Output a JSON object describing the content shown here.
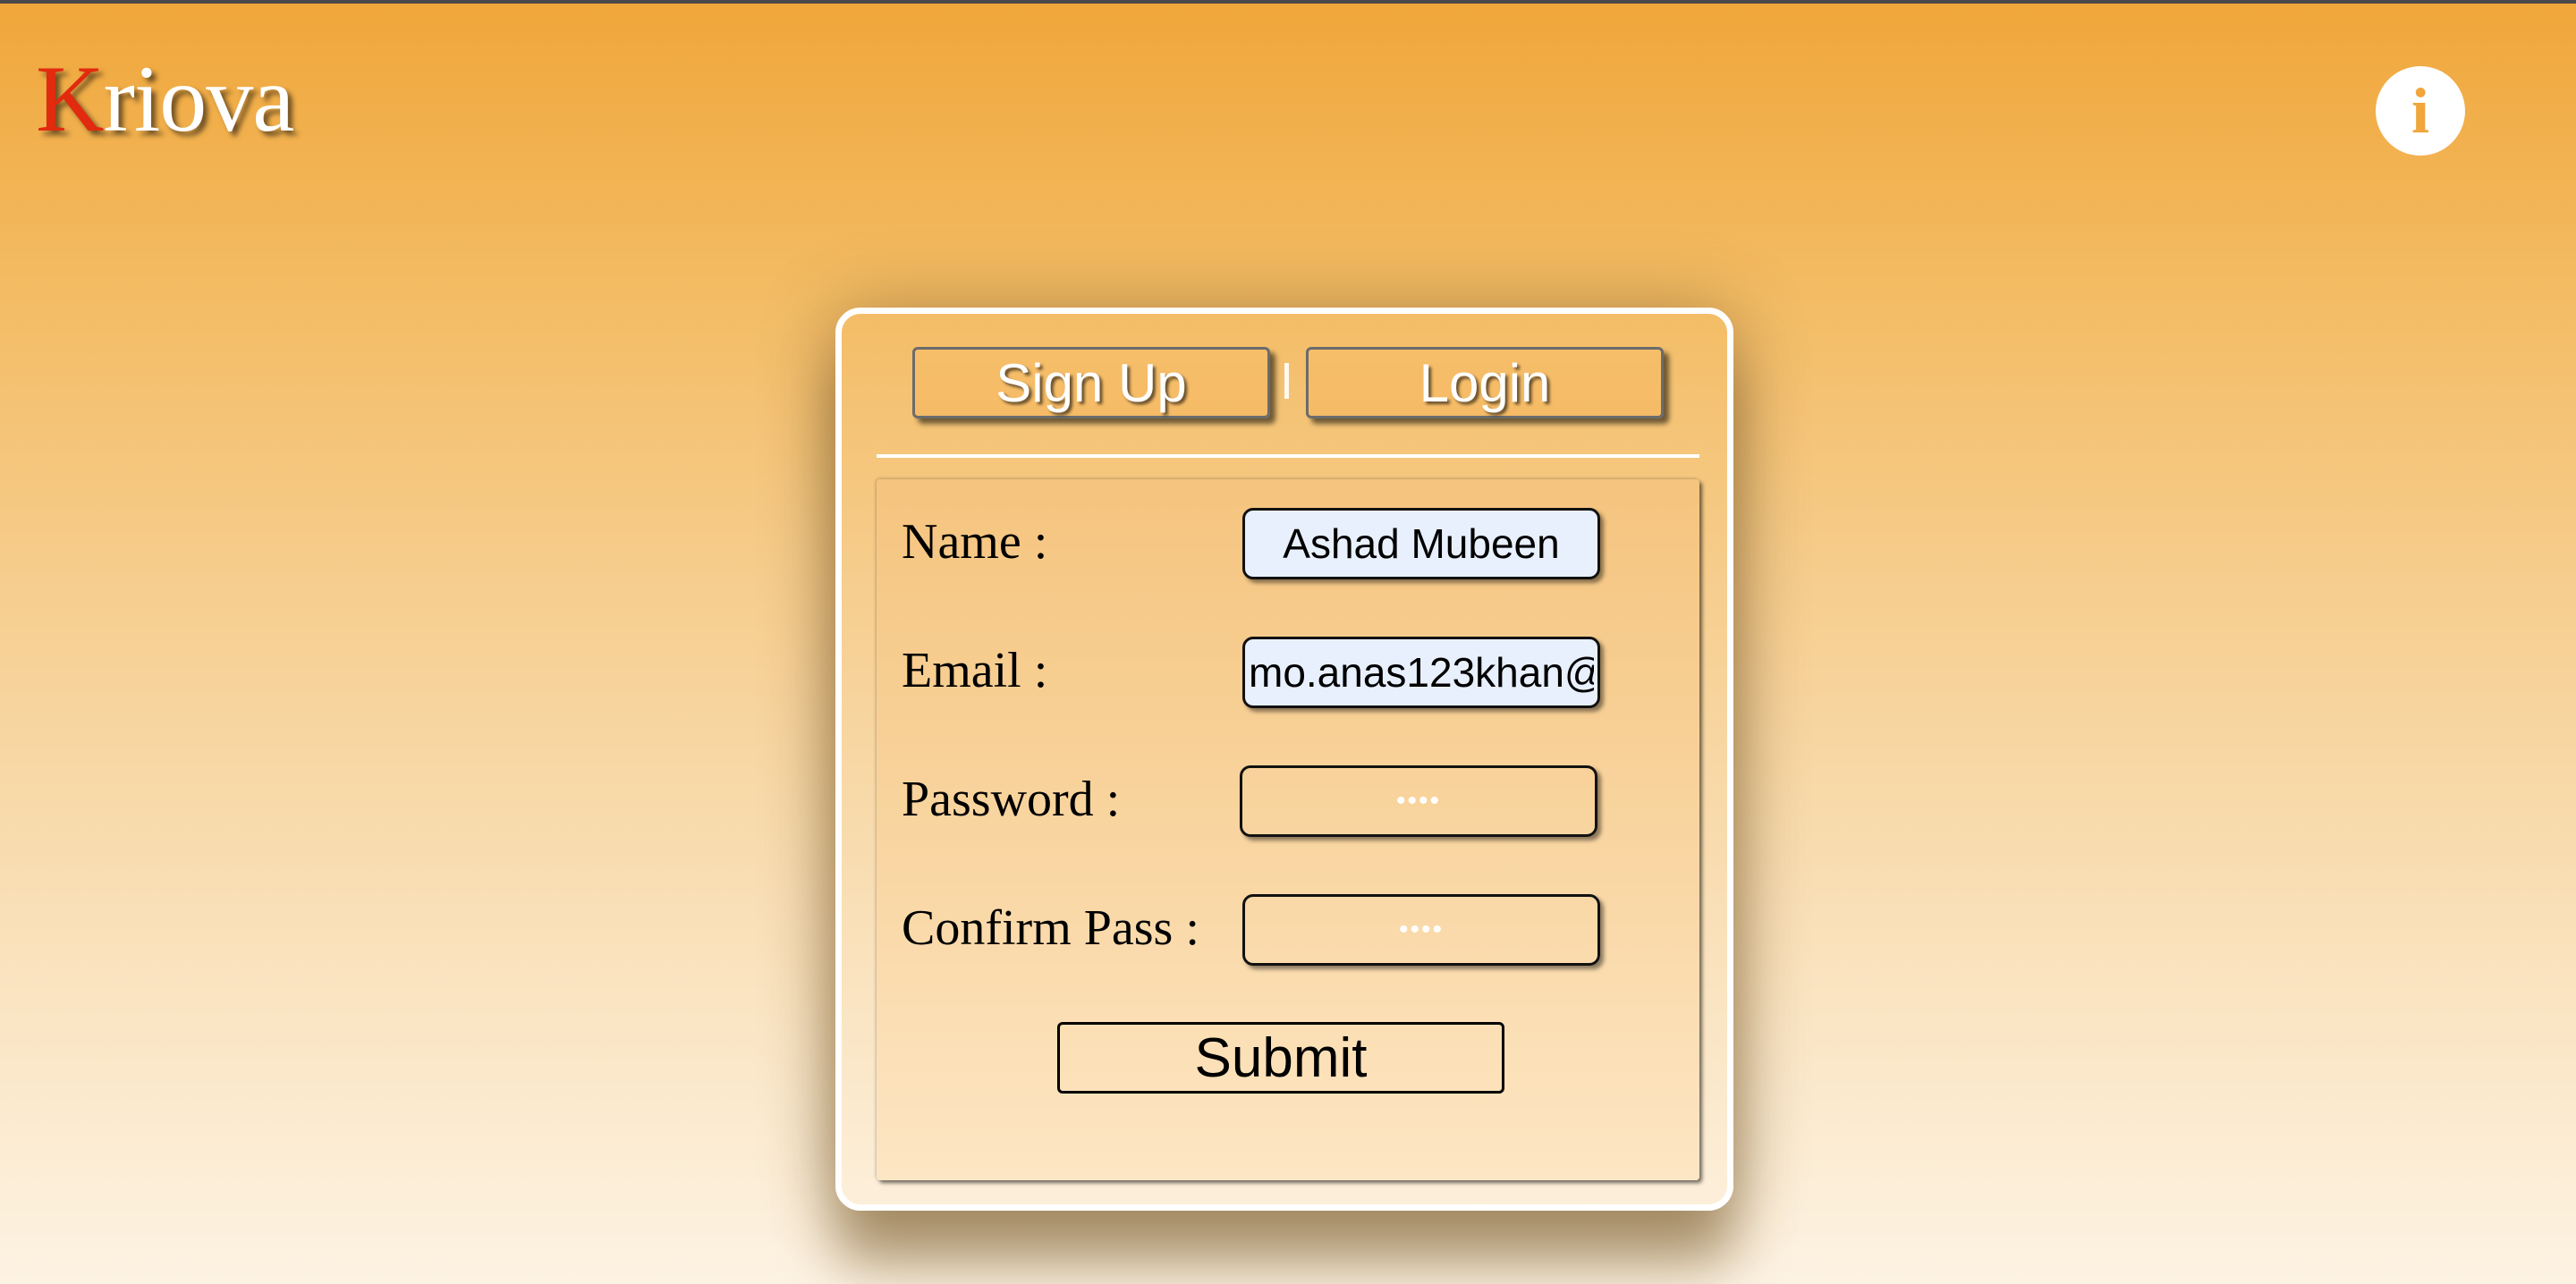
{
  "app": {
    "logo_first": "K",
    "logo_rest": "riova",
    "info_glyph": "i"
  },
  "auth_tabs": {
    "signup_label": "Sign Up",
    "login_label": "Login",
    "separator": "|"
  },
  "form": {
    "name_label": "Name :",
    "name_value": "Ashad Mubeen",
    "email_label": "Email :",
    "email_value": "mo.anas123khan@",
    "password_label": "Password :",
    "password_value": "••••",
    "confirm_label": "Confirm Pass :",
    "confirm_value": "••••",
    "submit_label": "Submit"
  },
  "colors": {
    "accent": "#f0a63a",
    "logo_k": "#e22a0e",
    "autofill_bg": "#e8f0fe"
  }
}
